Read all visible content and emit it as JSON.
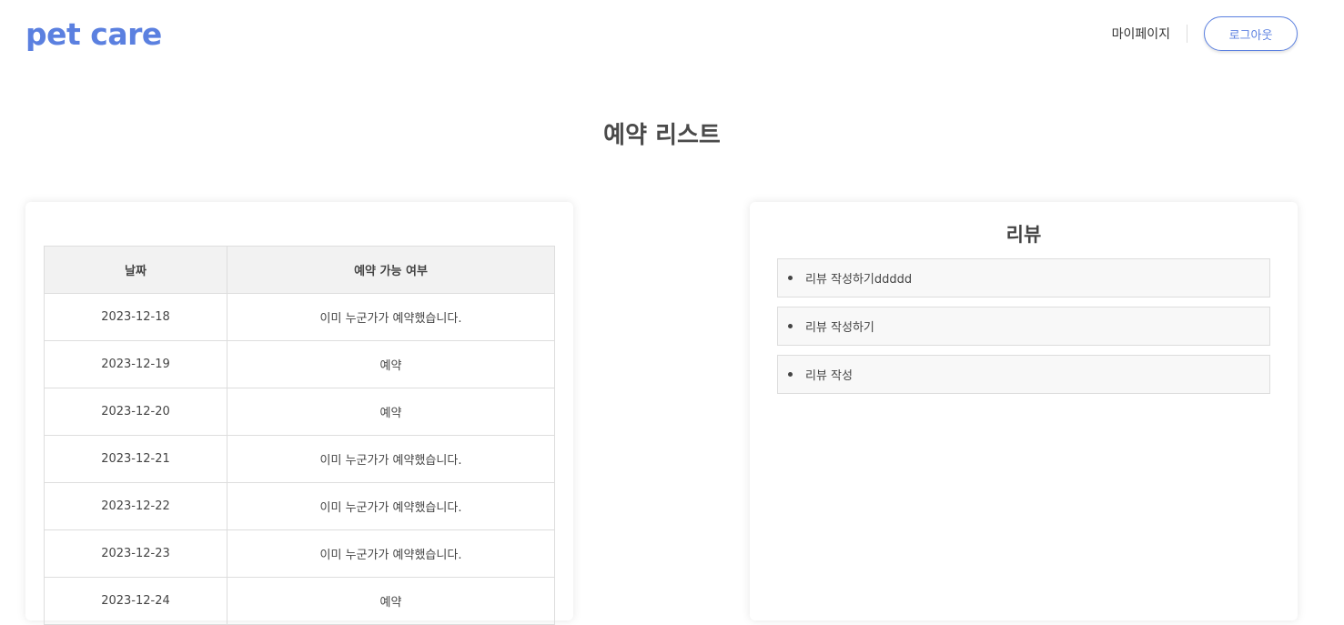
{
  "header": {
    "logo": "pet care",
    "mypage_label": "마이페이지",
    "logout_label": "로그아웃"
  },
  "page_title": "예약 리스트",
  "reservation_table": {
    "headers": [
      "날짜",
      "예약 가능 여부"
    ],
    "rows": [
      {
        "date": "2023-12-18",
        "status": "이미 누군가가 예약했습니다."
      },
      {
        "date": "2023-12-19",
        "status": "예약"
      },
      {
        "date": "2023-12-20",
        "status": "예약"
      },
      {
        "date": "2023-12-21",
        "status": "이미 누군가가 예약했습니다."
      },
      {
        "date": "2023-12-22",
        "status": "이미 누군가가 예약했습니다."
      },
      {
        "date": "2023-12-23",
        "status": "이미 누군가가 예약했습니다."
      },
      {
        "date": "2023-12-24",
        "status": "예약"
      }
    ]
  },
  "reviews": {
    "title": "리뷰",
    "items": [
      {
        "text": "리뷰 작성하기ddddd"
      },
      {
        "text": "리뷰 작성하기"
      },
      {
        "text": "리뷰 작성"
      }
    ]
  },
  "colors": {
    "brand": "#5b80e0",
    "text": "#444444",
    "border": "#dddddd",
    "header_bg": "#f2f2f2"
  }
}
